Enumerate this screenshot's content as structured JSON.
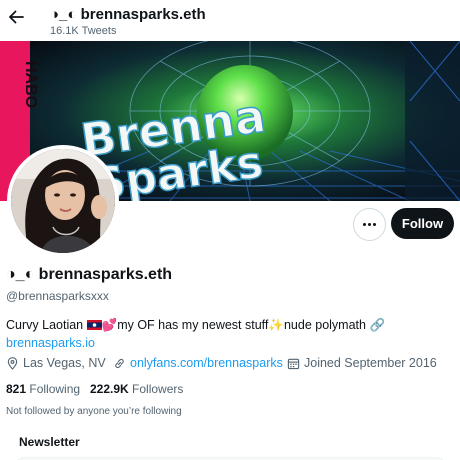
{
  "header": {
    "name": "◑_◐ brennasparks.eth",
    "tweet_count": "16.1K Tweets"
  },
  "banner": {
    "graphic_text": [
      "Brenna",
      "Sparks"
    ],
    "side_text": "HABO"
  },
  "actions": {
    "follow_label": "Follow"
  },
  "profile": {
    "display_name": "◑_◐ brennasparks.eth",
    "handle": "@brennasparksxxx",
    "bio_prefix": "Curvy Laotian ",
    "bio_emoji_heart": "💕",
    "bio_middle": "my OF has my newest stuff",
    "bio_emoji_sparkle": "✨",
    "bio_suffix": "nude polymath ",
    "bio_link_emoji": "🔗",
    "bio_link": "brennasparks.io"
  },
  "meta": {
    "location": "Las Vegas, NV",
    "website": "onlyfans.com/brennasparks",
    "joined": "Joined September 2016"
  },
  "stats": {
    "following_count": "821",
    "following_label": "Following",
    "followers_count": "222.9K",
    "followers_label": "Followers"
  },
  "not_followed_text": "Not followed by anyone you’re following",
  "newsletter": {
    "title": "Newsletter"
  },
  "colors": {
    "accent": "#1d9bf0",
    "follow_button": "#0f1419",
    "secondary_text": "#536471",
    "banner_neon_green": "#3fe05a",
    "banner_grid_blue": "#2a6fd6"
  }
}
